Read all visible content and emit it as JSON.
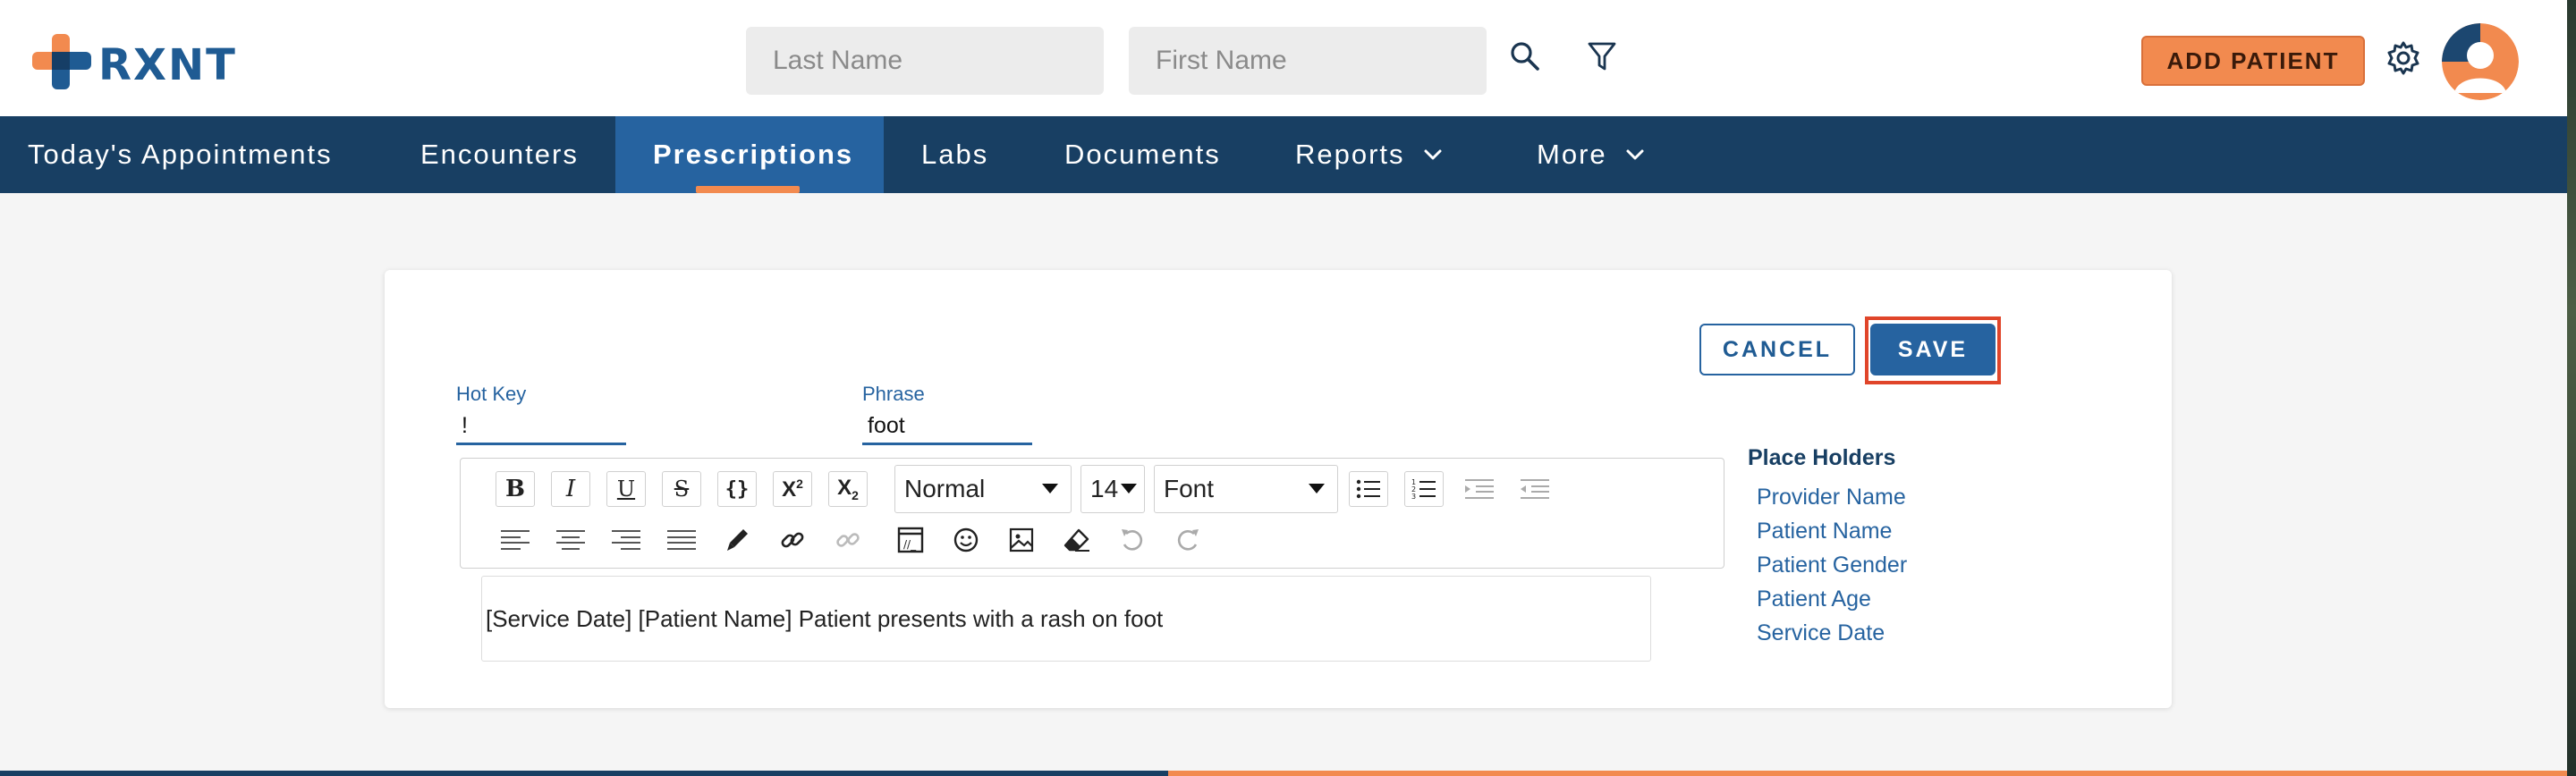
{
  "app": {
    "logo_text": "RXNT",
    "brand_blue": "#1f5b93",
    "brand_orange": "#f28a4f",
    "nav_bg": "#183f63",
    "nav_active_bg": "#2663a0"
  },
  "header": {
    "last_name_placeholder": "Last Name",
    "first_name_placeholder": "First Name",
    "search_icon": "search-icon",
    "filter_icon": "filter-icon",
    "add_patient_label": "ADD PATIENT",
    "settings_icon": "gear-icon",
    "avatar_icon": "user-avatar-icon"
  },
  "nav": {
    "items": [
      {
        "label": "Today's Appointments",
        "active": false,
        "has_dropdown": false
      },
      {
        "label": "Encounters",
        "active": false,
        "has_dropdown": false
      },
      {
        "label": "Prescriptions",
        "active": true,
        "has_dropdown": false
      },
      {
        "label": "Labs",
        "active": false,
        "has_dropdown": false
      },
      {
        "label": "Documents",
        "active": false,
        "has_dropdown": false
      },
      {
        "label": "Reports",
        "active": false,
        "has_dropdown": true
      },
      {
        "label": "More",
        "active": false,
        "has_dropdown": true
      }
    ]
  },
  "form": {
    "cancel_label": "CANCEL",
    "save_label": "SAVE",
    "hot_key_label": "Hot Key",
    "hot_key_value": "!",
    "phrase_label": "Phrase",
    "phrase_value": "foot",
    "editor": {
      "block_format": "Normal",
      "font_size": "14",
      "font_family": "Font",
      "content": "[Service Date] [Patient Name] Patient presents with a rash on foot",
      "toolbar_icons": [
        "bold-icon",
        "italic-icon",
        "underline-icon",
        "strikethrough-icon",
        "code-icon",
        "superscript-icon",
        "subscript-icon",
        "bullet-list-icon",
        "numbered-list-icon",
        "indent-icon",
        "outdent-icon",
        "align-left-icon",
        "align-center-icon",
        "align-right-icon",
        "align-justify-icon",
        "color-picker-icon",
        "link-icon",
        "unlink-icon",
        "embed-icon",
        "emoji-icon",
        "image-icon",
        "eraser-icon",
        "undo-icon",
        "redo-icon"
      ]
    },
    "placeholders": {
      "title": "Place Holders",
      "items": [
        "Provider Name",
        "Patient Name",
        "Patient Gender",
        "Patient Age",
        "Service Date"
      ]
    }
  }
}
